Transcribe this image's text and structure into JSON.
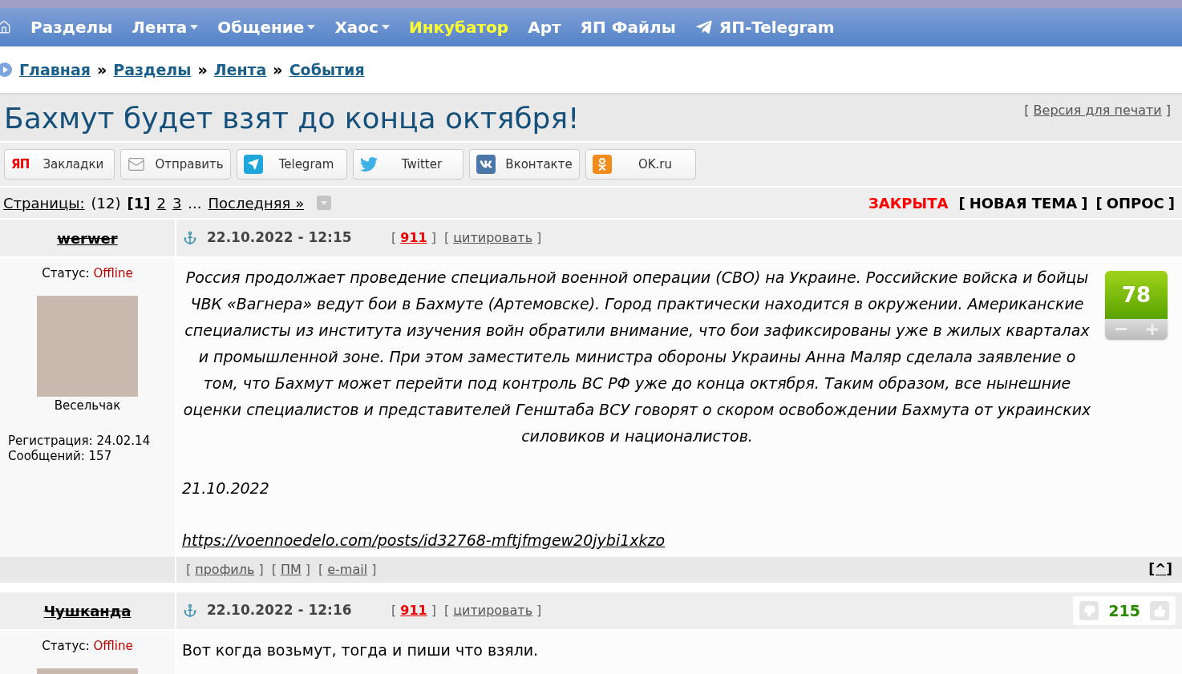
{
  "nav": {
    "items": [
      {
        "label": "Разделы",
        "dropdown": false,
        "highlighted": false,
        "kind": "plain"
      },
      {
        "label": "Лента",
        "dropdown": true,
        "highlighted": false,
        "kind": "plain"
      },
      {
        "label": "Общение",
        "dropdown": true,
        "highlighted": false,
        "kind": "plain"
      },
      {
        "label": "Хаос",
        "dropdown": true,
        "highlighted": false,
        "kind": "plain"
      },
      {
        "label": "Инкубатор",
        "dropdown": false,
        "highlighted": true,
        "kind": "plain"
      },
      {
        "label": "Арт",
        "dropdown": false,
        "highlighted": false,
        "kind": "plain"
      },
      {
        "label": "ЯП Файлы",
        "dropdown": false,
        "highlighted": false,
        "kind": "plain"
      },
      {
        "label": "ЯП-Telegram",
        "dropdown": false,
        "highlighted": false,
        "kind": "telegram"
      }
    ]
  },
  "breadcrumb": [
    "Главная",
    "Разделы",
    "Лента",
    "События"
  ],
  "breadcrumb_separator": "»",
  "bracket_open": "[",
  "bracket_close": "]",
  "topic": {
    "title": "Бахмут будет взят до конца октября!",
    "print_link": "Версия для печати"
  },
  "share_buttons": [
    {
      "kind": "yap",
      "logo": "ЯП",
      "label": "Закладки"
    },
    {
      "kind": "mail",
      "label": "Отправить"
    },
    {
      "kind": "telegram",
      "label": "Telegram"
    },
    {
      "kind": "twitter",
      "label": "Twitter"
    },
    {
      "kind": "vk",
      "label": "Вконтакте"
    },
    {
      "kind": "ok",
      "label": "OK.ru"
    }
  ],
  "pagination": {
    "label": "Страницы:",
    "count": "(12)",
    "current": "[1]",
    "pages": [
      "2",
      "3"
    ],
    "ellipsis": "...",
    "last": "Последняя »"
  },
  "topic_status": {
    "state": "ЗАКРЫТА",
    "actions": [
      "НОВАЯ ТЕМА",
      "ОПРОС"
    ]
  },
  "posts": [
    {
      "author": "werwer",
      "banned": true,
      "status_label": "Статус:",
      "status": "Offline",
      "rank": "Весельчак",
      "registration": "Регистрация: 24.02.14",
      "messages": "Сообщений: 157",
      "date": "22.10.2022 - 12:15",
      "number": "911",
      "quote": "цитировать",
      "rating": {
        "kind": "box",
        "value": "78"
      },
      "italic": true,
      "paragraphs": [
        {
          "kind": "centered",
          "text": "Россия продолжает проведение специальной военной операции (СВО) на Украине. Российские войска и бойцы ЧВК «Вагнера» ведут бои в Бахмуте (Артемовске). Город практически находится в окружении. Американские специалисты из института изучения войн обратили внимание, что бои зафиксированы уже в жилых кварталах и промышленной зоне. При этом заместитель министра обороны Украины Анна Маляр сделала заявление о том, что Бахмут может перейти под контроль ВС РФ уже до конца октября. Таким образом, все нынешние оценки специалистов и представителей Генштаба ВСУ говорят о скором освобождении Бахмута от украинских силовиков и националистов."
        },
        {
          "kind": "plain",
          "text": "21.10.2022"
        },
        {
          "kind": "link",
          "text": "https://voennoedelo.com/posts/id32768-mftjfmgew20jybi1xkzo"
        }
      ],
      "footer_links": [
        "профиль",
        "ПМ",
        "e-mail"
      ],
      "top_link": "[^]"
    },
    {
      "author": "Чушканда",
      "banned": true,
      "status_label": "Статус:",
      "status": "Offline",
      "date": "22.10.2022 - 12:16",
      "number": "911",
      "quote": "цитировать",
      "rating": {
        "kind": "thumbs",
        "value": "215"
      },
      "italic": false,
      "paragraphs": [
        {
          "kind": "plain",
          "text": "Вот когда возьмут, тогда и пиши что взяли."
        }
      ]
    }
  ]
}
